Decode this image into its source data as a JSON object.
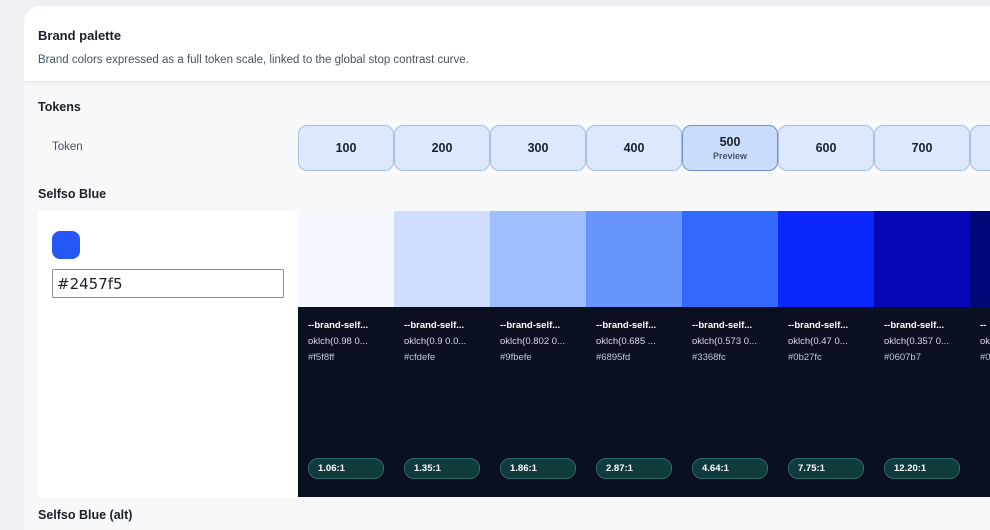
{
  "header": {
    "title": "Brand palette",
    "subtitle": "Brand colors expressed as a full token scale, linked to the global stop contrast curve."
  },
  "tokens_section": {
    "label": "Tokens",
    "row_label": "Token",
    "buttons": [
      {
        "label": "100",
        "sub": ""
      },
      {
        "label": "200",
        "sub": ""
      },
      {
        "label": "300",
        "sub": ""
      },
      {
        "label": "400",
        "sub": ""
      },
      {
        "label": "500",
        "sub": "Preview"
      },
      {
        "label": "600",
        "sub": ""
      },
      {
        "label": "700",
        "sub": ""
      },
      {
        "label": "",
        "sub": ""
      }
    ],
    "active_index": 4
  },
  "palettes": [
    {
      "name": "Selfso Blue",
      "base_hex": "#2457f5",
      "swatches": [
        {
          "name": "--brand-self...",
          "oklch": "oklch(0.98 0...",
          "hex": "#f5f8ff",
          "ratio": "1.06:1"
        },
        {
          "name": "--brand-self...",
          "oklch": "oklch(0.9 0.0...",
          "hex": "#cfdefe",
          "ratio": "1.35:1"
        },
        {
          "name": "--brand-self...",
          "oklch": "oklch(0.802 0...",
          "hex": "#9fbefe",
          "ratio": "1.86:1"
        },
        {
          "name": "--brand-self...",
          "oklch": "oklch(0.685 ...",
          "hex": "#6895fd",
          "ratio": "2.87:1"
        },
        {
          "name": "--brand-self...",
          "oklch": "oklch(0.573 0...",
          "hex": "#3368fc",
          "ratio": "4.64:1"
        },
        {
          "name": "--brand-self...",
          "oklch": "oklch(0.47 0...",
          "hex": "#0b27fc",
          "ratio": "7.75:1"
        },
        {
          "name": "--brand-self...",
          "oklch": "oklch(0.357 0...",
          "hex": "#0607b7",
          "ratio": "12.20:1"
        },
        {
          "name": "--",
          "oklch": "ok",
          "hex": "#0",
          "ratio": "",
          "swatch_color": "#00087a"
        }
      ]
    },
    {
      "name": "Selfso Blue (alt)"
    }
  ],
  "colors": {
    "dark_panel": "#0b1021",
    "pill_bg": "#0f3b3c",
    "token_btn_bg": "#dbe8ff"
  }
}
